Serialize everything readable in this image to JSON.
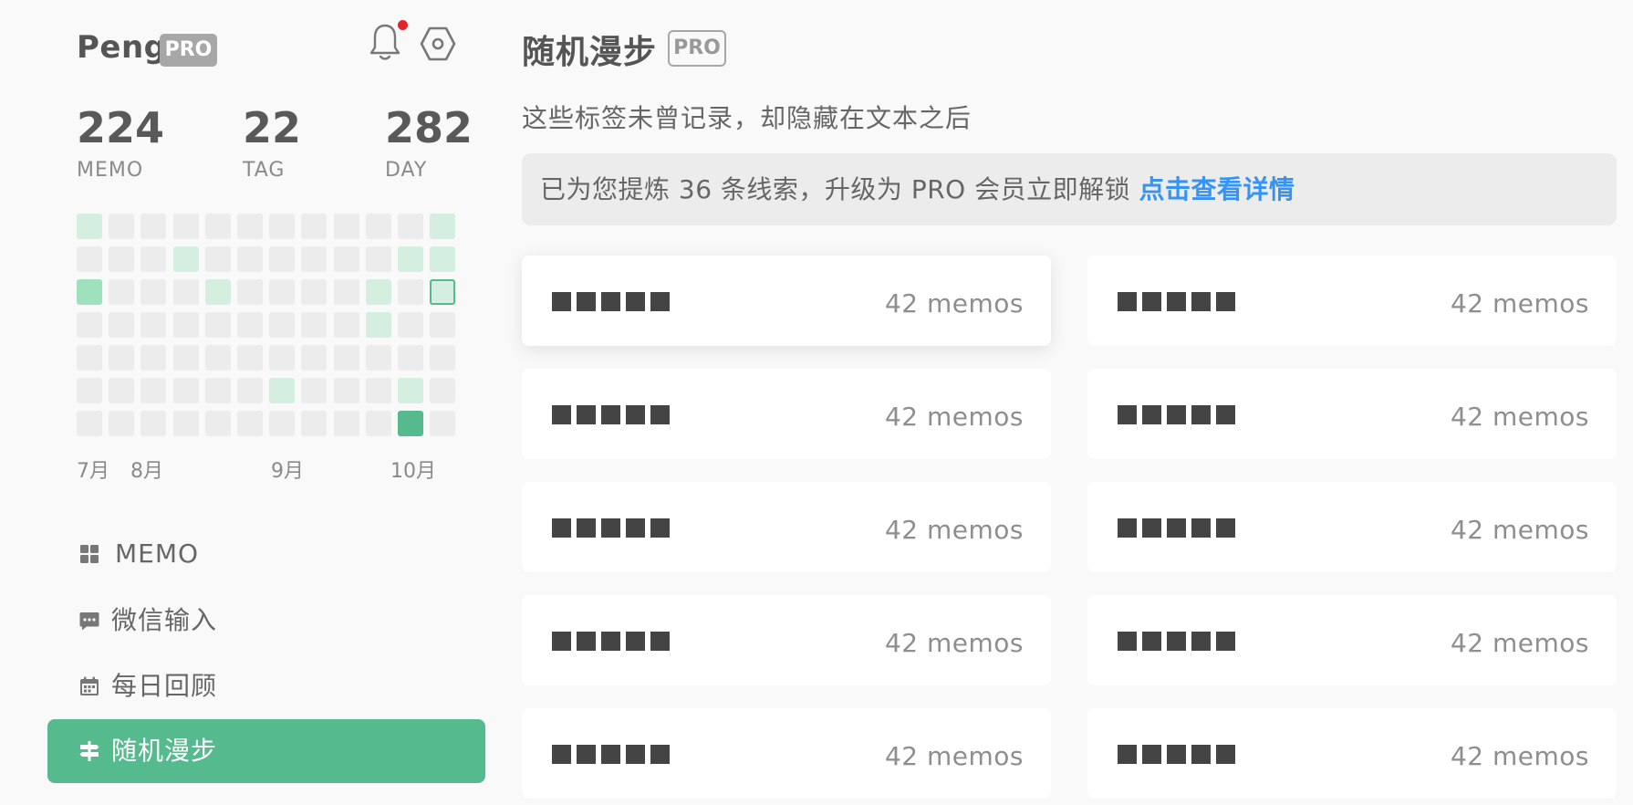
{
  "user": {
    "name": "Peng",
    "badge": "PRO"
  },
  "header_icons": {
    "bell": "bell-icon",
    "settings": "gear-icon",
    "notification_dot_color": "#e4232b"
  },
  "stats": [
    {
      "value": "224",
      "label": "MEMO"
    },
    {
      "value": "22",
      "label": "TAG"
    },
    {
      "value": "282",
      "label": "DAY"
    }
  ],
  "heatmap": {
    "colors": {
      "empty": "#ececec",
      "l1": "#d4eedf",
      "l2": "#9fe0bd",
      "l3": "#55bb8e",
      "today_border": "#55bb8e"
    },
    "levels": [
      [
        1,
        0,
        0,
        0,
        0,
        0,
        0,
        0,
        0,
        0,
        0,
        1
      ],
      [
        0,
        0,
        0,
        1,
        0,
        0,
        0,
        0,
        0,
        0,
        1,
        1
      ],
      [
        2,
        0,
        0,
        0,
        1,
        0,
        0,
        0,
        0,
        1,
        0,
        -1
      ],
      [
        0,
        0,
        0,
        0,
        0,
        0,
        0,
        0,
        0,
        1,
        0,
        0
      ],
      [
        0,
        0,
        0,
        0,
        0,
        0,
        0,
        0,
        0,
        0,
        0,
        0
      ],
      [
        0,
        0,
        0,
        0,
        0,
        0,
        1,
        0,
        0,
        0,
        1,
        0
      ],
      [
        0,
        0,
        0,
        0,
        0,
        0,
        0,
        0,
        0,
        0,
        3,
        0
      ]
    ],
    "months": [
      "7月",
      "8月",
      "9月",
      "10月"
    ]
  },
  "nav": [
    {
      "label": "MEMO",
      "icon": "grid-icon",
      "active": false
    },
    {
      "label": "微信输入",
      "icon": "chat-icon",
      "active": false
    },
    {
      "label": "每日回顾",
      "icon": "calendar-icon",
      "active": false
    },
    {
      "label": "随机漫步",
      "icon": "signpost-icon",
      "active": true
    }
  ],
  "main": {
    "title": "随机漫步",
    "title_badge": "PRO",
    "subtitle": "这些标签未曾记录，却隐藏在文本之后",
    "banner": {
      "text": "已为您提炼 36 条线索，升级为 PRO 会员立即解锁",
      "link": "点击查看详情",
      "link_color": "#3493f5"
    },
    "tags": [
      {
        "count": "42 memos"
      },
      {
        "count": "42 memos"
      },
      {
        "count": "42 memos"
      },
      {
        "count": "42 memos"
      },
      {
        "count": "42 memos"
      },
      {
        "count": "42 memos"
      },
      {
        "count": "42 memos"
      },
      {
        "count": "42 memos"
      },
      {
        "count": "42 memos"
      },
      {
        "count": "42 memos"
      }
    ]
  },
  "accent_color": "#55bb8e"
}
